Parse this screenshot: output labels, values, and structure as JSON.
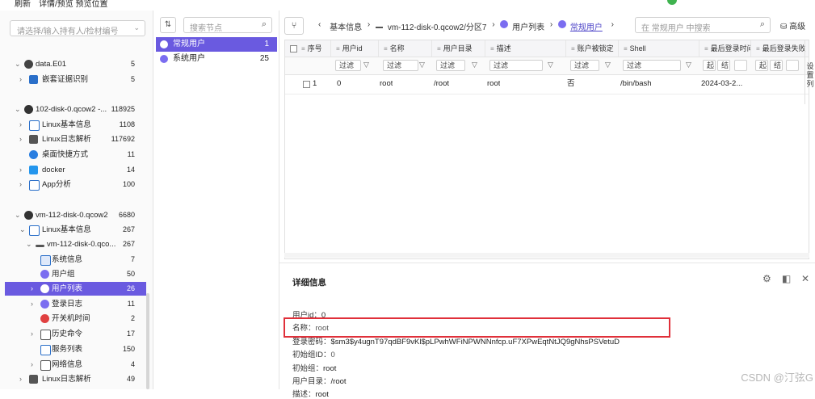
{
  "menubar": {
    "refresh": "刷新",
    "details": "详情/预览 预览位置"
  },
  "left": {
    "owner_placeholder": "请选择/输入持有人/检材编号",
    "tree": [
      {
        "label": "data.E01",
        "count": "5"
      },
      {
        "label": "嵌套证据识别",
        "count": "5"
      },
      {
        "label": "102-disk-0.qcow2 -...",
        "count": "118925"
      },
      {
        "label": "Linux基本信息",
        "count": "1108"
      },
      {
        "label": "Linux日志解析",
        "count": "117692"
      },
      {
        "label": "桌面快捷方式",
        "count": "11"
      },
      {
        "label": "docker",
        "count": "14"
      },
      {
        "label": "App分析",
        "count": "100"
      },
      {
        "label": "vm-112-disk-0.qcow2",
        "count": "6680"
      },
      {
        "label": "Linux基本信息",
        "count": "267"
      },
      {
        "label": "vm-112-disk-0.qco...",
        "count": "267"
      },
      {
        "label": "系统信息",
        "count": "7"
      },
      {
        "label": "用户组",
        "count": "50"
      },
      {
        "label": "用户列表",
        "count": "26"
      },
      {
        "label": "登录日志",
        "count": "11"
      },
      {
        "label": "开关机时间",
        "count": "2"
      },
      {
        "label": "历史命令",
        "count": "17"
      },
      {
        "label": "服务列表",
        "count": "150"
      },
      {
        "label": "网络信息",
        "count": "4"
      },
      {
        "label": "Linux日志解析",
        "count": "49"
      }
    ]
  },
  "middle": {
    "search_placeholder": "搜索节点",
    "items": [
      {
        "label": "常规用户",
        "count": "1"
      },
      {
        "label": "系统用户",
        "count": "25"
      }
    ]
  },
  "right": {
    "breadcrumbs": [
      "基本信息",
      "vm-112-disk-0.qcow2/分区7",
      "用户列表",
      "常规用户"
    ],
    "search_placeholder": "在 常规用户 中搜索",
    "advanced": "高级",
    "columns": [
      "序号",
      "用户id",
      "名称",
      "用户目录",
      "描述",
      "账户被锁定",
      "Shell",
      "最后登录时间",
      "最后登录失败"
    ],
    "filter_label": "过滤",
    "range_start": "起",
    "range_end": "结",
    "row": {
      "index": "1",
      "uid": "0",
      "name": "root",
      "home": "/root",
      "desc": "root",
      "locked": "否",
      "shell": "/bin/bash",
      "last_login": "2024-03-2..."
    },
    "settings_label": "设置列"
  },
  "detail": {
    "title": "详细信息",
    "fields": [
      {
        "key": "用户id：",
        "value": "0"
      },
      {
        "key": "名称：",
        "value": "root"
      },
      {
        "key": "登录密码：",
        "value": "$sm3$y4ugnT97qdBF9vKl$pLPwhWFiNPWNNnfcp.uF7XPwEqtNtJQ9gNhsPSVetuD"
      },
      {
        "key": "初始组ID：",
        "value": "0"
      },
      {
        "key": "初始组：",
        "value": "root"
      },
      {
        "key": "用户目录：",
        "value": "/root"
      },
      {
        "key": "描述：",
        "value": "root"
      }
    ]
  },
  "watermark": "CSDN @汀弦G"
}
